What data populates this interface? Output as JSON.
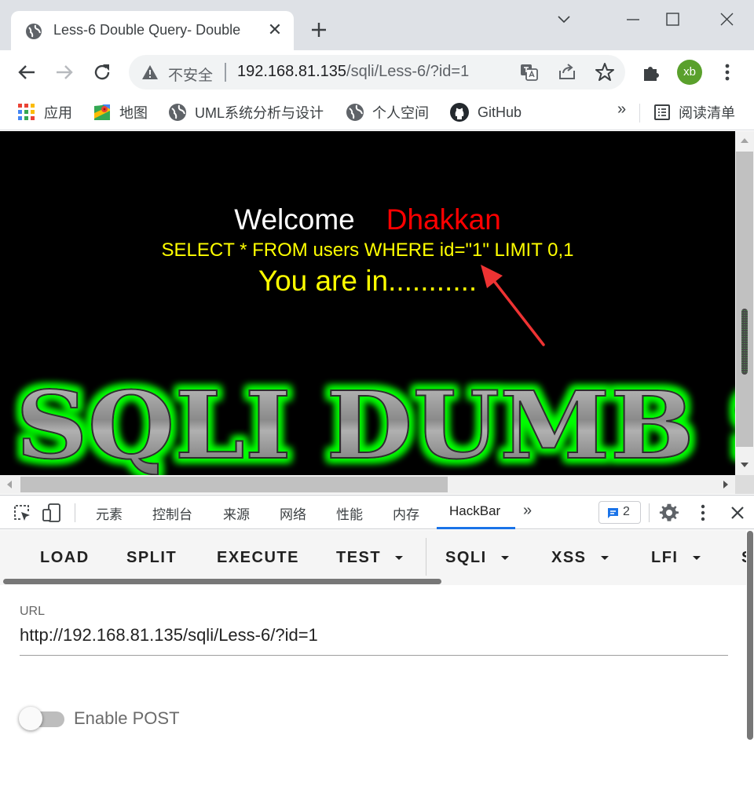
{
  "browser": {
    "tab": {
      "title": "Less-6 Double Query- Double",
      "close": "✕",
      "favicon": "globe-icon"
    },
    "new_tab": "+",
    "omnibox": {
      "security_label": "不安全",
      "url_host": "192.168.81.135",
      "url_path": "/sqli/Less-6/?id=1"
    },
    "profile_initials": "xb",
    "bookmarks": [
      {
        "label": "应用",
        "icon": "apps-grid-icon"
      },
      {
        "label": "地图",
        "icon": "maps-icon"
      },
      {
        "label": "UML系统分析与设计",
        "icon": "globe-icon"
      },
      {
        "label": "个人空间",
        "icon": "globe-icon"
      },
      {
        "label": "GitHub",
        "icon": "github-icon"
      }
    ],
    "bookmarks_more": "»",
    "reading_list": "阅读清单"
  },
  "page": {
    "welcome": "Welcome",
    "name": "Dhakkan",
    "query": "SELECT * FROM users WHERE id=\"1\" LIMIT 0,1",
    "result": "You are in...........",
    "banner_text": "SQLI DUMB S",
    "colors": {
      "background": "#000000",
      "name": "#ff0000",
      "query": "#ffff00",
      "banner_glow": "#00ff00"
    }
  },
  "devtools": {
    "tabs": [
      "元素",
      "控制台",
      "来源",
      "网络",
      "性能",
      "内存",
      "HackBar"
    ],
    "active_tab": "HackBar",
    "more_tabs": "»",
    "issues_count": "2"
  },
  "hackbar": {
    "buttons": [
      {
        "label": "LOAD",
        "dropdown": false
      },
      {
        "label": "SPLIT",
        "dropdown": false
      },
      {
        "label": "EXECUTE",
        "dropdown": false
      },
      {
        "label": "TEST",
        "dropdown": true
      },
      {
        "label": "SQLI",
        "dropdown": true
      },
      {
        "label": "XSS",
        "dropdown": true
      },
      {
        "label": "LFI",
        "dropdown": true
      },
      {
        "label": "S",
        "dropdown": false
      }
    ],
    "url_label": "URL",
    "url_value": "http://192.168.81.135/sqli/Less-6/?id=1",
    "enable_post_label": "Enable POST",
    "enable_post": false
  }
}
